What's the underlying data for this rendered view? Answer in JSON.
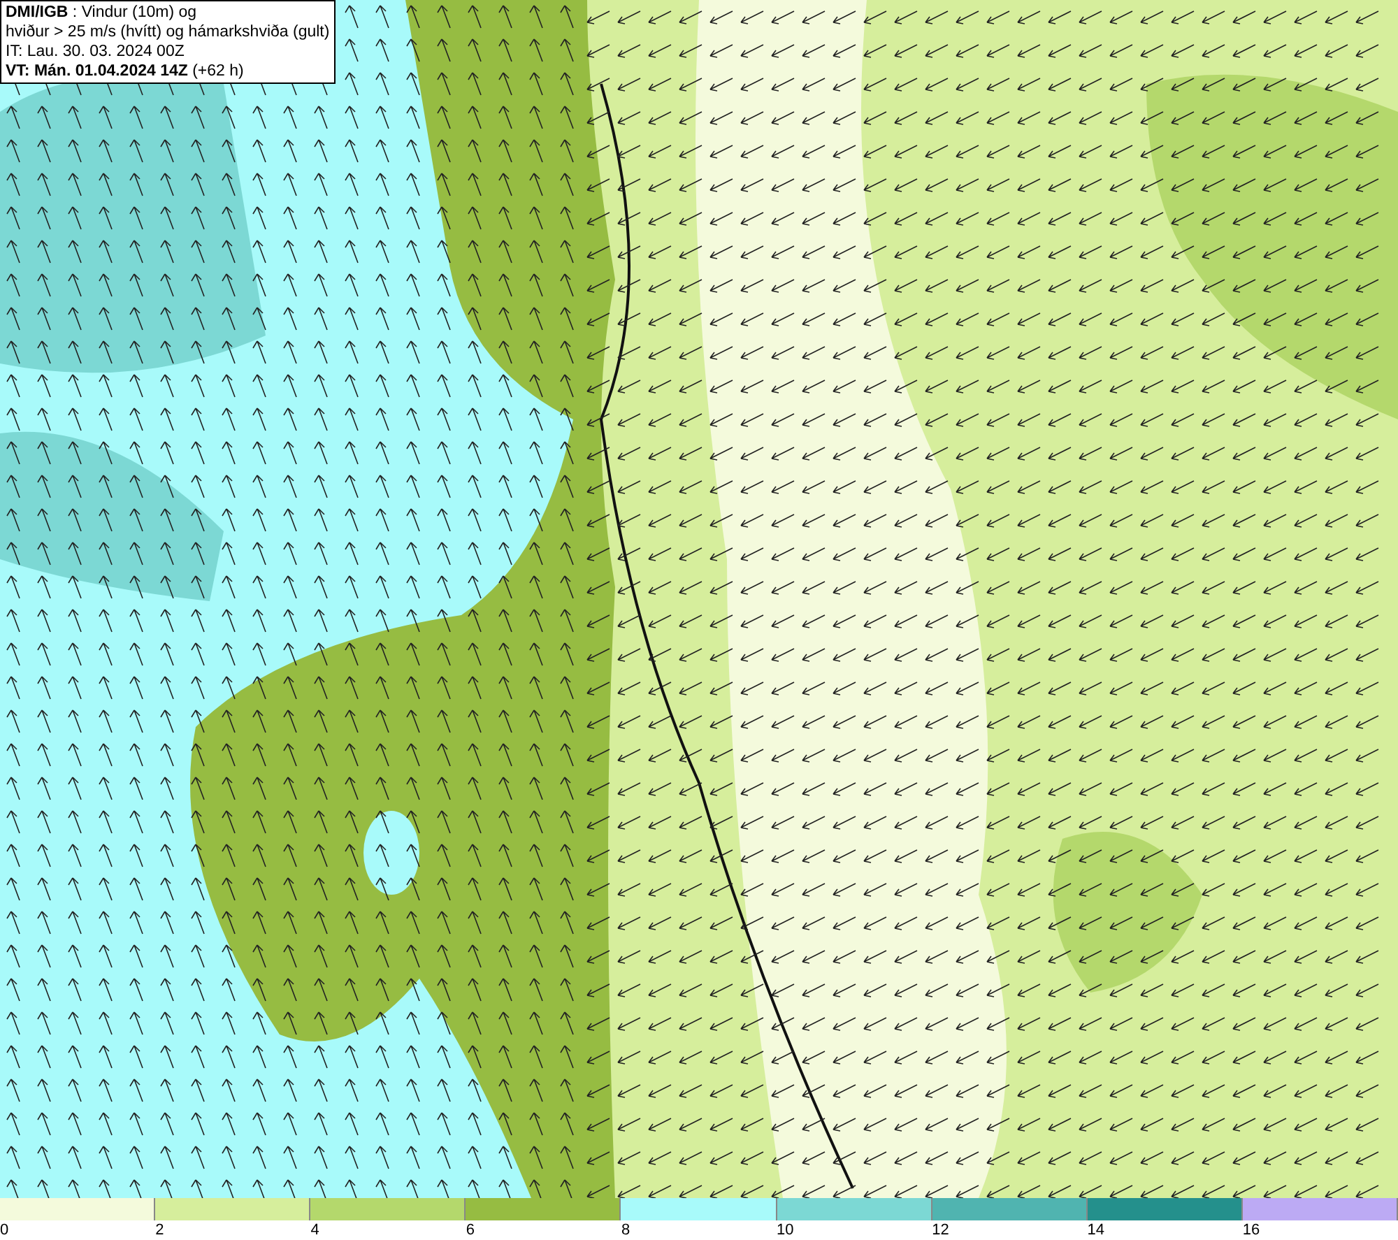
{
  "title_box": {
    "lines": [
      "**DMI/IGB** : Vindur (10m) og",
      "hviður > 25 m/s (hvítt) og hámarkshviða (gult)",
      "IT: Lau. 30. 03. 2024 00Z",
      "**VT: Mán. 01.04.2024 14Z** (+62 h)"
    ]
  },
  "legend": [
    {
      "label": "0",
      "color": "#f4fadc"
    },
    {
      "label": "2",
      "color": "#d6ee9c"
    },
    {
      "label": "4",
      "color": "#b4d86c"
    },
    {
      "label": "6",
      "color": "#96bc42"
    },
    {
      "label": "8",
      "color": "#a8fafa"
    },
    {
      "label": "10",
      "color": "#7cd8d4"
    },
    {
      "label": "12",
      "color": "#50b4b0"
    },
    {
      "label": "14",
      "color": "#24908c"
    },
    {
      "label": "16",
      "color": "#bcaaf4"
    }
  ]
}
